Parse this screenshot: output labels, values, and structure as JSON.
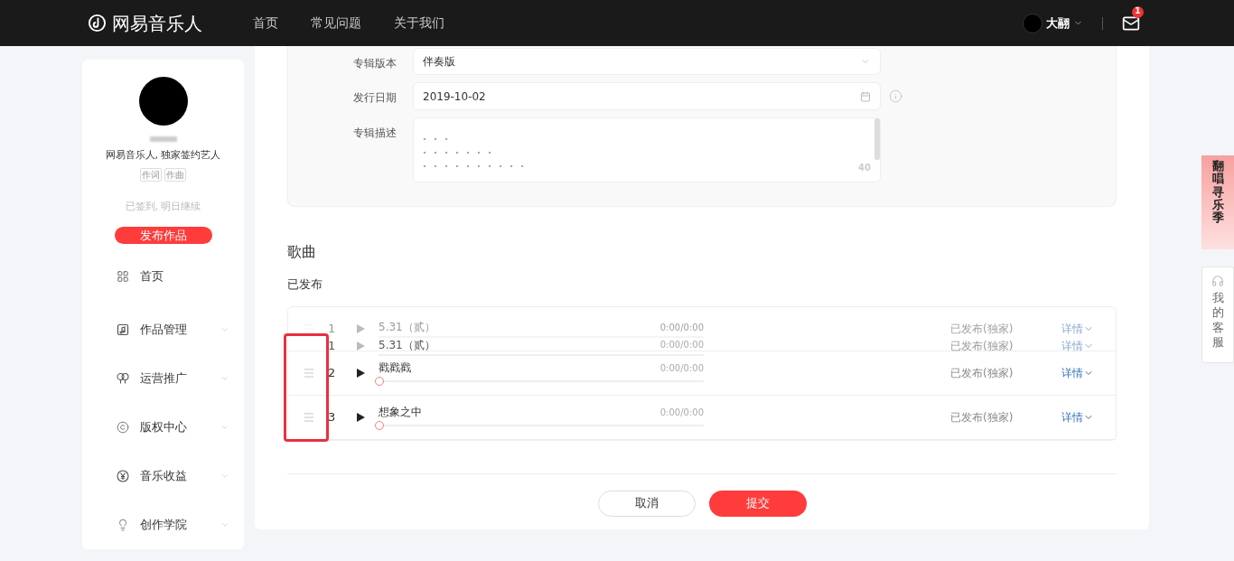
{
  "header": {
    "logo": "网易音乐人",
    "nav": [
      {
        "label": "首页",
        "selected": false
      },
      {
        "label": "常见问题",
        "selected": false
      },
      {
        "label": "关于我们",
        "selected": false
      }
    ],
    "user": {
      "name": "大翮"
    },
    "mail": {
      "badge": "1"
    }
  },
  "sidebar": {
    "subtitle": "网易音乐人, 独家签约艺人",
    "tags": [
      "作词",
      "作曲"
    ],
    "checkin": "已签到, 明日继续",
    "publish_button": "发布作品",
    "items": [
      {
        "label": "首页",
        "expandable": false
      },
      {
        "label": "作品管理",
        "expandable": true
      },
      {
        "label": "运营推广",
        "expandable": true
      },
      {
        "label": "版权中心",
        "expandable": true
      },
      {
        "label": "音乐收益",
        "expandable": true
      },
      {
        "label": "创作学院",
        "expandable": true
      }
    ]
  },
  "form": {
    "fields": [
      {
        "label": "专辑版本",
        "kind": "select",
        "value": "伴奏版"
      },
      {
        "label": "发行日期",
        "kind": "date",
        "value": "2019-10-02"
      },
      {
        "label": "专辑描述",
        "kind": "textarea",
        "lines": [
          "。。。",
          "。。。。。。。",
          "。。。。。。。。。。"
        ],
        "counter": "40"
      }
    ]
  },
  "songs": {
    "title": "歌曲",
    "subtitle": "已发布",
    "rows": [
      {
        "kind": "placeholder",
        "index": "1",
        "title": "5.31（贰）",
        "time": "0:00/0:00",
        "status": "已发布(独家)",
        "detail": "详情"
      },
      {
        "kind": "normal",
        "index": "2",
        "title": "戳戳戳",
        "time": "0:00/0:00",
        "status": "已发布(独家)",
        "detail": "详情"
      },
      {
        "kind": "normal",
        "index": "3",
        "title": "想象之中",
        "time": "0:00/0:00",
        "status": "已发布(独家)",
        "detail": "详情"
      }
    ],
    "dragged_row": {
      "index": "1",
      "title": "5.31（贰）",
      "time": "0:00/0:00",
      "status": "已发布(独家)",
      "detail": "详情"
    }
  },
  "buttons": [
    {
      "label": "取消",
      "kind": "secondary"
    },
    {
      "label": "提交",
      "kind": "primary"
    }
  ],
  "side_widgets": {
    "banner": "翻唱寻乐季",
    "service": "我的客服"
  }
}
